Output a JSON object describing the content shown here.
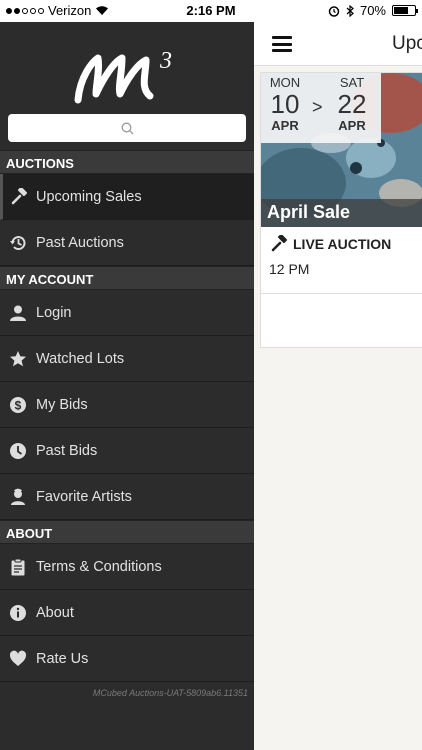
{
  "status_bar": {
    "carrier": "Verizon",
    "time": "2:16 PM",
    "battery": "70%",
    "battery_level": 0.7
  },
  "drawer": {
    "search": {
      "placeholder": ""
    },
    "sections": [
      {
        "title": "AUCTIONS",
        "items": [
          {
            "label": "Upcoming Sales",
            "icon": "gavel-icon",
            "active": true
          },
          {
            "label": "Past Auctions",
            "icon": "history-icon"
          }
        ]
      },
      {
        "title": "MY ACCOUNT",
        "items": [
          {
            "label": "Login",
            "icon": "user-icon"
          },
          {
            "label": "Watched Lots",
            "icon": "star-icon"
          },
          {
            "label": "My Bids",
            "icon": "dollar-icon"
          },
          {
            "label": "Past Bids",
            "icon": "clock-icon"
          },
          {
            "label": "Favorite Artists",
            "icon": "artist-icon"
          }
        ]
      },
      {
        "title": "ABOUT",
        "items": [
          {
            "label": "Terms & Conditions",
            "icon": "clipboard-icon"
          },
          {
            "label": "About",
            "icon": "info-icon"
          },
          {
            "label": "Rate Us",
            "icon": "heart-icon"
          }
        ]
      }
    ],
    "version": "MCubed Auctions-UAT-5809ab6.11351"
  },
  "main": {
    "title": "Upcoming Sales",
    "sale": {
      "start_dow": "MON",
      "start_day": "10",
      "start_month": "APR",
      "arrow": ">",
      "end_dow": "SAT",
      "end_day": "22",
      "end_month": "APR",
      "name": "April Sale",
      "type": "LIVE AUCTION",
      "time": "12 PM"
    }
  },
  "colors": {
    "drawer_bg": "#2c2c2c",
    "section_bg": "#3a3a3a",
    "main_bg": "#f5f4f0"
  }
}
